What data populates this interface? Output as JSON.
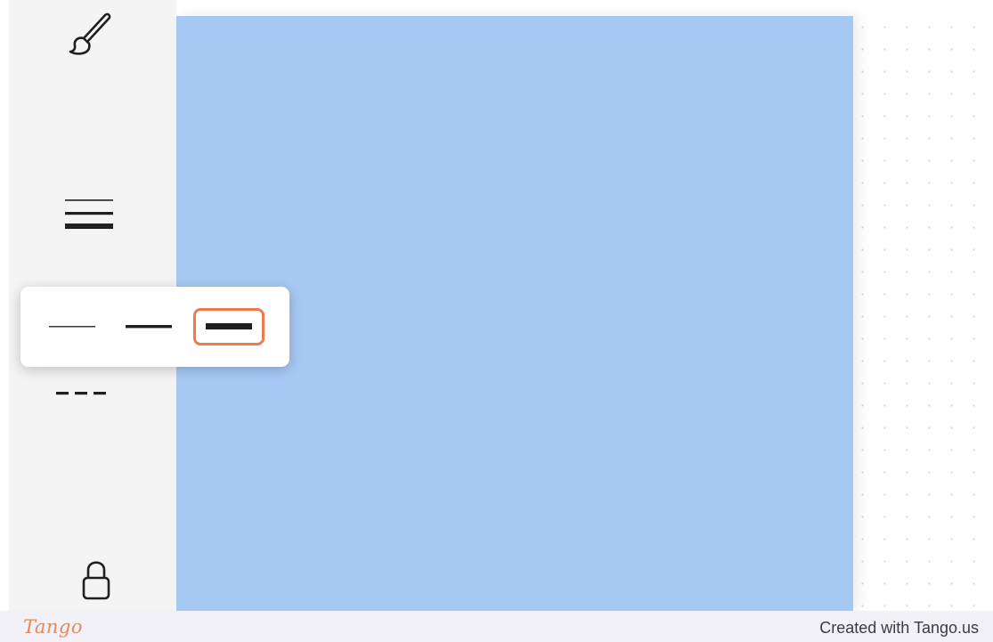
{
  "toolbar": {
    "tools": [
      {
        "name": "brush",
        "icon": "brush-icon"
      },
      {
        "name": "stroke-thickness",
        "icon": "stroke-thickness-icon"
      },
      {
        "name": "dash-style",
        "icon": "dashed-line-icon"
      },
      {
        "name": "lock",
        "icon": "lock-icon"
      }
    ]
  },
  "canvas": {
    "shape_color": "#a6c9f3",
    "background": "dot-grid"
  },
  "stroke_popover": {
    "options": [
      {
        "weight": "thin",
        "icon": "thin-line-icon"
      },
      {
        "weight": "medium",
        "icon": "medium-line-icon"
      },
      {
        "weight": "thick",
        "icon": "thick-line-icon",
        "highlighted": true
      }
    ],
    "highlight_color": "#ee7a4e"
  },
  "footer": {
    "logo": "Tango",
    "credit": "Created with Tango.us"
  }
}
